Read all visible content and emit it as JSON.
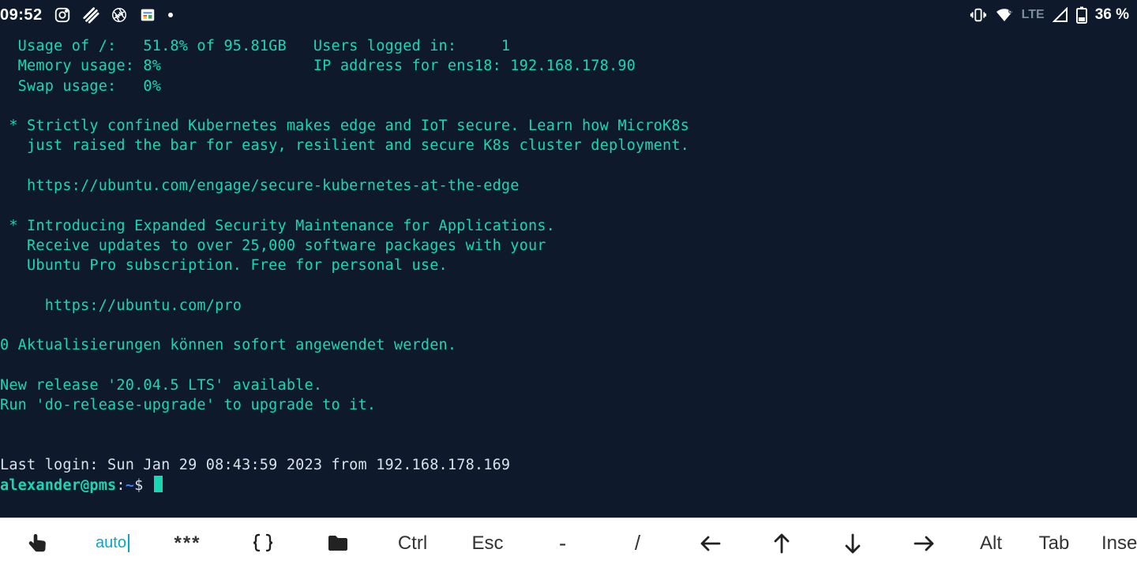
{
  "statusbar": {
    "time": "09:52",
    "network_label": "LTE",
    "battery_text": "36 %"
  },
  "terminal": {
    "lines": [
      "  Usage of /:   51.8% of 95.81GB   Users logged in:     1",
      "  Memory usage: 8%                 IP address for ens18: 192.168.178.90",
      "  Swap usage:   0%",
      "",
      " * Strictly confined Kubernetes makes edge and IoT secure. Learn how MicroK8s",
      "   just raised the bar for easy, resilient and secure K8s cluster deployment.",
      "",
      "   https://ubuntu.com/engage/secure-kubernetes-at-the-edge",
      "",
      " * Introducing Expanded Security Maintenance for Applications.",
      "   Receive updates to over 25,000 software packages with your",
      "   Ubuntu Pro subscription. Free for personal use.",
      "",
      "     https://ubuntu.com/pro",
      "",
      "0 Aktualisierungen können sofort angewendet werden.",
      "",
      "New release '20.04.5 LTS' available.",
      "Run 'do-release-upgrade' to upgrade to it.",
      "",
      ""
    ],
    "last_login": "Last login: Sun Jan 29 08:43:59 2023 from 192.168.178.169",
    "prompt": {
      "user_host": "alexander@pms",
      "path": "~",
      "sep1": ":",
      "sep2": "$"
    }
  },
  "keyrow": {
    "auto": "auto",
    "stars": "***",
    "ctrl": "Ctrl",
    "esc": "Esc",
    "dash": "-",
    "slash": "/",
    "alt": "Alt",
    "tab": "Tab",
    "insert": "Insert"
  }
}
